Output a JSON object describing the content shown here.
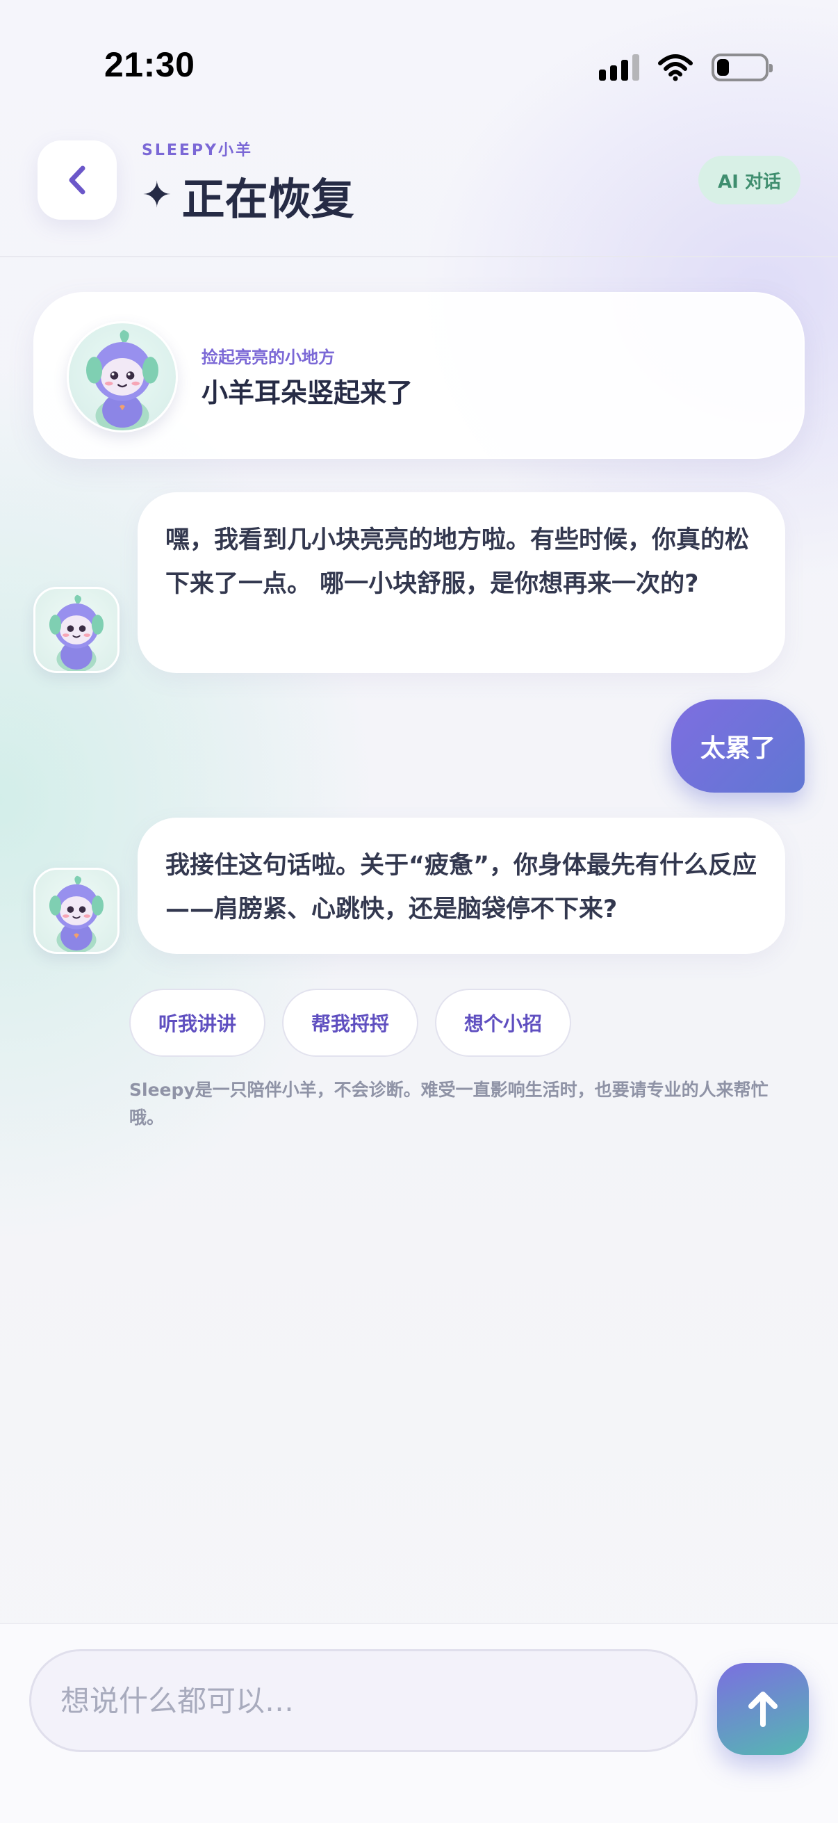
{
  "status_bar": {
    "time": "21:30",
    "battery_level": 0.25
  },
  "header": {
    "brand": "SLEEPY小羊",
    "title_icon": "✦",
    "title": "正在恢复",
    "badge": "AI 对话",
    "back_icon": "chevron-left-icon"
  },
  "highlight_card": {
    "kicker": "捡起亮亮的小地方",
    "title": "小羊耳朵竖起来了"
  },
  "messages": [
    {
      "role": "bot",
      "text": "嘿，我看到几小块亮亮的地方啦。有些时候，你真的松下来了一点。 哪一小块舒服，是你想再来一次的?"
    },
    {
      "role": "user",
      "text": "太累了"
    },
    {
      "role": "bot",
      "text": "我接住这句话啦。关于“疲惫”，你身体最先有什么反应——肩膀紧、心跳快，还是脑袋停不下来?"
    }
  ],
  "quick_replies": [
    "听我讲讲",
    "帮我捋捋",
    "想个小招"
  ],
  "disclaimer": "Sleepy是一只陪伴小羊，不会诊断。难受一直影响生活时，也要请专业的人来帮忙哦。",
  "composer": {
    "placeholder": "想说什么都可以…",
    "value": "",
    "send_icon": "arrow-up-icon"
  },
  "colors": {
    "accent": "#7b68d6",
    "badge_bg": "#d8f0e6",
    "badge_text": "#3f8e6f",
    "user_bubble": "#6f72dc"
  }
}
